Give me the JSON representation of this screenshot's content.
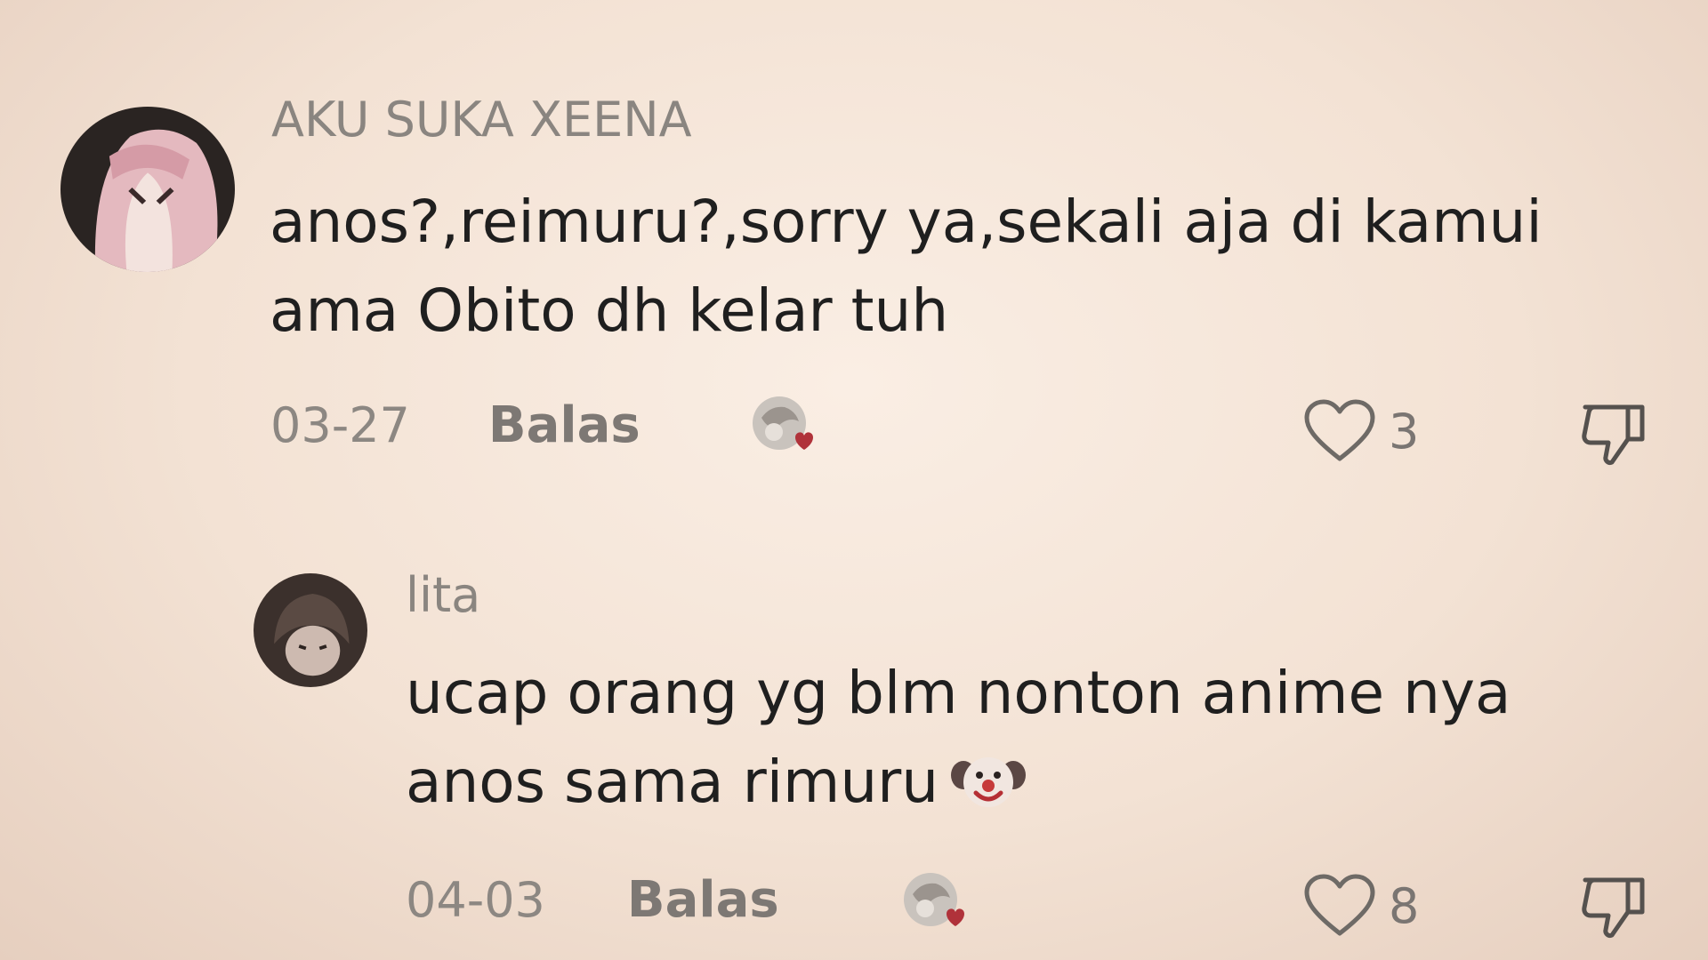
{
  "comments": [
    {
      "username": "AKU SUKA XEENA",
      "text_line1": "anos?,reimuru?,sorry ya,sekali aja di kamui",
      "text_line2": "ama Obito dh kelar tuh",
      "date": "03-27",
      "reply_label": "Balas",
      "likes": "3",
      "avatar_icon": "anime-avatar-pink-hair",
      "creator_liked_icon": "creator-liked-heart-icon"
    },
    {
      "username": "lita",
      "text_line1": "ucap orang yg blm nonton anime nya",
      "text_line2": "anos sama rimuru",
      "text_emoji": "clown-face-emoji",
      "date": "04-03",
      "reply_label": "Balas",
      "likes": "8",
      "avatar_icon": "anime-avatar-dark-hair",
      "creator_liked_icon": "creator-liked-heart-icon"
    }
  ],
  "colors": {
    "background": "#f5e6d8",
    "username": "#8a8580",
    "text": "#1f1f1f",
    "meta": "#8c8782",
    "heart_badge": "#b0323a"
  }
}
